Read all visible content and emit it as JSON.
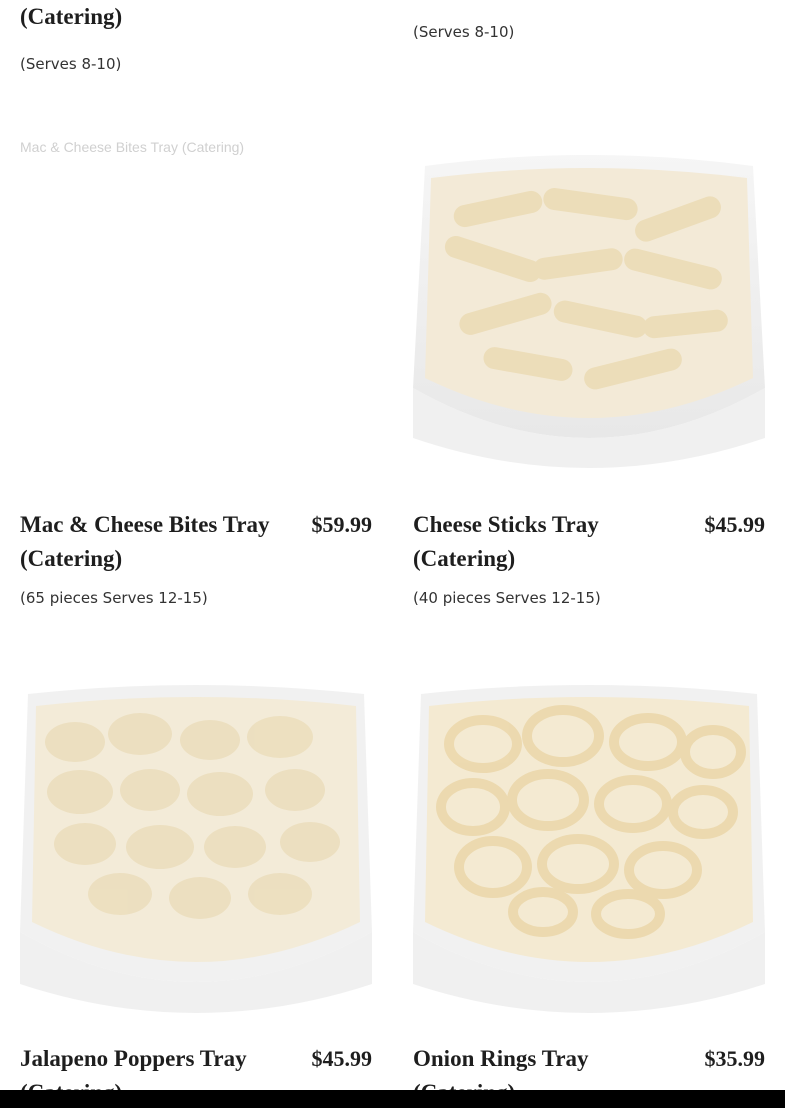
{
  "items": [
    {
      "name": "(Catering)",
      "price": "",
      "desc": "(Serves 8-10)"
    },
    {
      "name": "",
      "price": "",
      "desc": "(Serves 8-10)"
    },
    {
      "name": "Mac & Cheese Bites Tray (Catering)",
      "price": "$59.99",
      "desc": "(65 pieces Serves 12-15)",
      "image_alt": "Mac & Cheese Bites Tray (Catering)"
    },
    {
      "name": "Cheese Sticks Tray (Catering)",
      "price": "$45.99",
      "desc": "(40 pieces Serves 12-15)",
      "image_alt": "Cheese Sticks Tray (Catering)"
    },
    {
      "name": "Jalapeno Poppers Tray (Catering)",
      "price": "$45.99",
      "image_alt": "Jalapeno Poppers Tray (Catering)"
    },
    {
      "name": "Onion Rings Tray (Catering)",
      "price": "$35.99",
      "image_alt": "Onion Rings Tray (Catering)"
    }
  ],
  "colors": {
    "text": "#1e1e1e",
    "desc_text": "#333333",
    "alt_text": "#d0d0d0",
    "bottom_bar": "#000000",
    "tray_foil": "#e6e6e6",
    "fried_food": "#f0e3c4"
  }
}
